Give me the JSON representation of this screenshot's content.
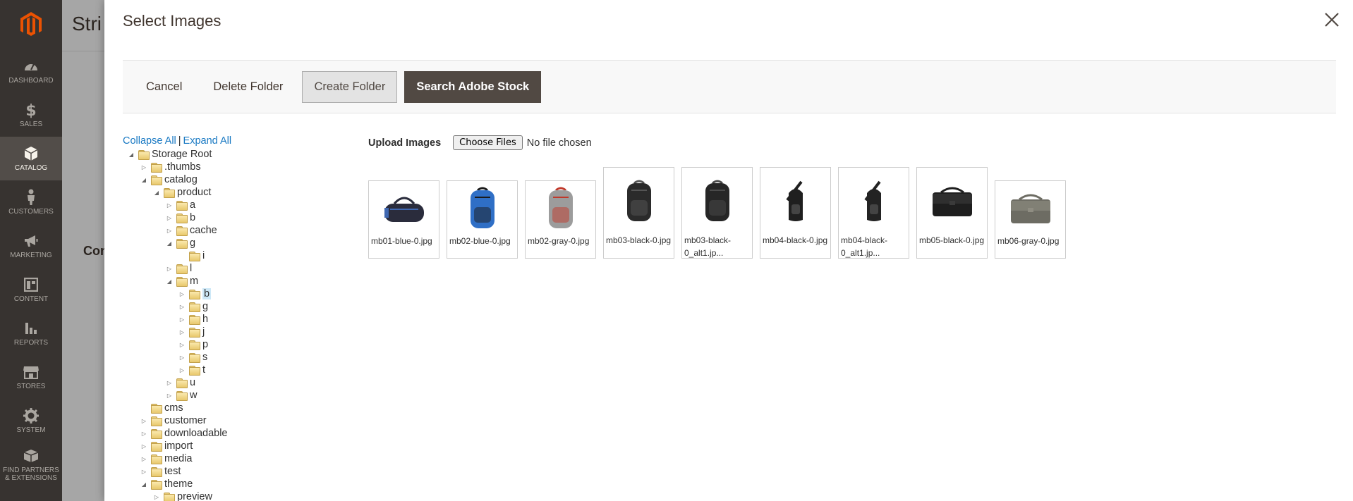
{
  "sidebar": {
    "items": [
      {
        "label": "DASHBOARD",
        "icon": "dashboard-icon",
        "active": false
      },
      {
        "label": "SALES",
        "icon": "dollar-icon",
        "active": false
      },
      {
        "label": "CATALOG",
        "icon": "cube-icon",
        "active": true
      },
      {
        "label": "CUSTOMERS",
        "icon": "person-icon",
        "active": false
      },
      {
        "label": "MARKETING",
        "icon": "megaphone-icon",
        "active": false
      },
      {
        "label": "CONTENT",
        "icon": "layout-icon",
        "active": false
      },
      {
        "label": "REPORTS",
        "icon": "bar-chart-icon",
        "active": false
      },
      {
        "label": "STORES",
        "icon": "storefront-icon",
        "active": false
      },
      {
        "label": "SYSTEM",
        "icon": "gear-icon",
        "active": false
      },
      {
        "label": "FIND PARTNERS & EXTENSIONS",
        "icon": "box-icon",
        "active": false
      }
    ]
  },
  "background": {
    "title": "Stri",
    "section": "Con"
  },
  "modal": {
    "title": "Select Images",
    "toolbar": {
      "cancel": "Cancel",
      "delete_folder": "Delete Folder",
      "create_folder": "Create Folder",
      "search_adobe_stock": "Search Adobe Stock"
    },
    "tree_links": {
      "collapse": "Collapse All",
      "separator": "|",
      "expand": "Expand All"
    },
    "tree": [
      {
        "label": "Storage Root",
        "depth": 0,
        "state": "open"
      },
      {
        "label": ".thumbs",
        "depth": 1,
        "state": "closed"
      },
      {
        "label": "catalog",
        "depth": 1,
        "state": "open"
      },
      {
        "label": "product",
        "depth": 2,
        "state": "open"
      },
      {
        "label": "a",
        "depth": 3,
        "state": "closed"
      },
      {
        "label": "b",
        "depth": 3,
        "state": "closed"
      },
      {
        "label": "cache",
        "depth": 3,
        "state": "closed"
      },
      {
        "label": "g",
        "depth": 3,
        "state": "open"
      },
      {
        "label": "i",
        "depth": 4,
        "state": "leaf"
      },
      {
        "label": "l",
        "depth": 3,
        "state": "closed"
      },
      {
        "label": "m",
        "depth": 3,
        "state": "open"
      },
      {
        "label": "b",
        "depth": 4,
        "state": "closed",
        "selected": true
      },
      {
        "label": "g",
        "depth": 4,
        "state": "closed"
      },
      {
        "label": "h",
        "depth": 4,
        "state": "closed"
      },
      {
        "label": "j",
        "depth": 4,
        "state": "closed"
      },
      {
        "label": "p",
        "depth": 4,
        "state": "closed"
      },
      {
        "label": "s",
        "depth": 4,
        "state": "closed"
      },
      {
        "label": "t",
        "depth": 4,
        "state": "closed"
      },
      {
        "label": "u",
        "depth": 3,
        "state": "closed"
      },
      {
        "label": "w",
        "depth": 3,
        "state": "closed"
      },
      {
        "label": "cms",
        "depth": 1,
        "state": "leaf"
      },
      {
        "label": "customer",
        "depth": 1,
        "state": "closed"
      },
      {
        "label": "downloadable",
        "depth": 1,
        "state": "closed"
      },
      {
        "label": "import",
        "depth": 1,
        "state": "closed"
      },
      {
        "label": "media",
        "depth": 1,
        "state": "closed"
      },
      {
        "label": "test",
        "depth": 1,
        "state": "closed"
      },
      {
        "label": "theme",
        "depth": 1,
        "state": "open"
      },
      {
        "label": "preview",
        "depth": 2,
        "state": "closed"
      }
    ],
    "upload": {
      "label": "Upload Images",
      "button": "Choose Files",
      "status": "No file chosen"
    },
    "images": [
      {
        "caption": "mb01-blue-0.jpg",
        "kind": "duffel",
        "color": "#2a2c3c",
        "accent": "#3f67b0"
      },
      {
        "caption": "mb02-blue-0.jpg",
        "kind": "backpack",
        "color": "#2f6fc6",
        "accent": "#1b1b1b"
      },
      {
        "caption": "mb02-gray-0.jpg",
        "kind": "backpack",
        "color": "#9c9c9c",
        "accent": "#c0392b"
      },
      {
        "caption": "mb03-black-0.jpg",
        "kind": "backpack",
        "color": "#2b2b2b",
        "accent": "#555555"
      },
      {
        "caption": "mb03-black-0_alt1.jp...",
        "kind": "backpack",
        "color": "#262626",
        "accent": "#4a4a4a"
      },
      {
        "caption": "mb04-black-0.jpg",
        "kind": "sling",
        "color": "#1f1f1f",
        "accent": "#444444"
      },
      {
        "caption": "mb04-black-0_alt1.jp...",
        "kind": "sling",
        "color": "#232323",
        "accent": "#444444"
      },
      {
        "caption": "mb05-black-0.jpg",
        "kind": "messenger",
        "color": "#1e1e1e",
        "accent": "#3a3a3a"
      },
      {
        "caption": "mb06-gray-0.jpg",
        "kind": "messenger",
        "color": "#6d6c63",
        "accent": "#8f8d82"
      }
    ]
  }
}
